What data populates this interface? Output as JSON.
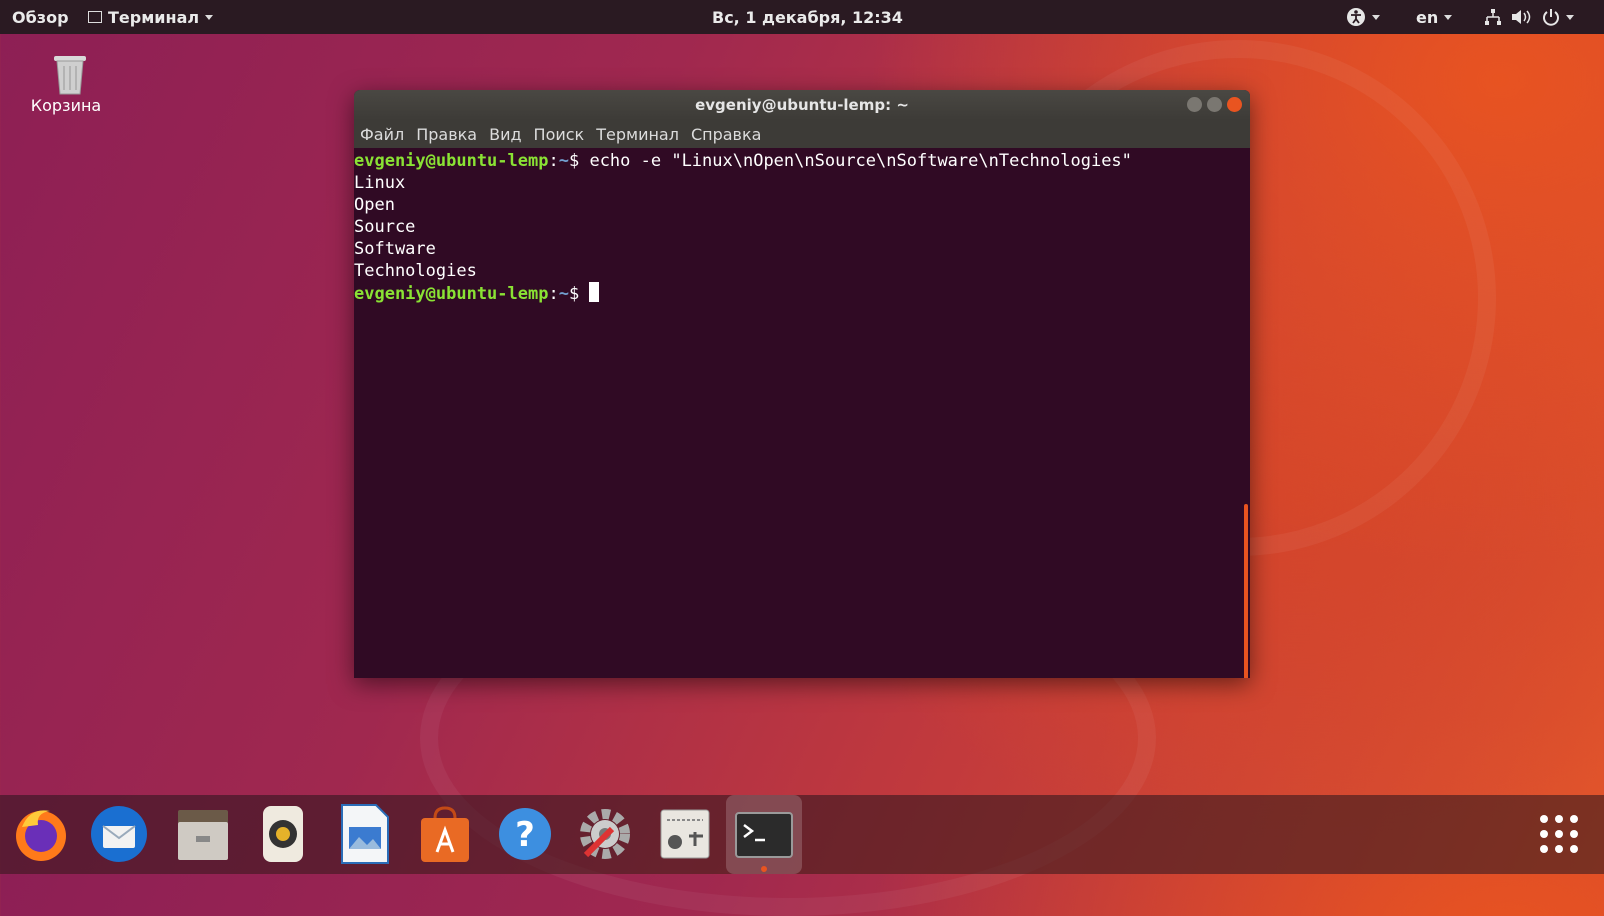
{
  "topbar": {
    "activities": "Обзор",
    "app_menu": "Терминал",
    "clock": "Вс, 1 декабря, 12:34",
    "lang": "en"
  },
  "desktop": {
    "trash_label": "Корзина"
  },
  "terminal": {
    "title": "evgeniy@ubuntu-lemp: ~",
    "menu": [
      "Файл",
      "Правка",
      "Вид",
      "Поиск",
      "Терминал",
      "Справка"
    ],
    "prompt_user": "evgeniy@ubuntu-lemp",
    "prompt_sep": ":",
    "prompt_path": "~",
    "prompt_sign": "$ ",
    "command": "echo -e \"Linux\\nOpen\\nSource\\nSoftware\\nTechnologies\"",
    "output": [
      "Linux",
      "Open",
      "Source",
      "Software",
      "Technologies"
    ]
  },
  "colors": {
    "accent": "#e95420",
    "terminal_bg": "#300a24",
    "prompt_user": "#8ae234",
    "prompt_path": "#729fcf"
  },
  "dock": {
    "icons": [
      "firefox-icon",
      "thunderbird-icon",
      "files-icon",
      "rhythmbox-icon",
      "libreoffice-writer-icon",
      "software-center-icon",
      "help-icon",
      "settings-icon",
      "system-monitor-icon",
      "terminal-icon",
      "show-apps-icon"
    ]
  }
}
